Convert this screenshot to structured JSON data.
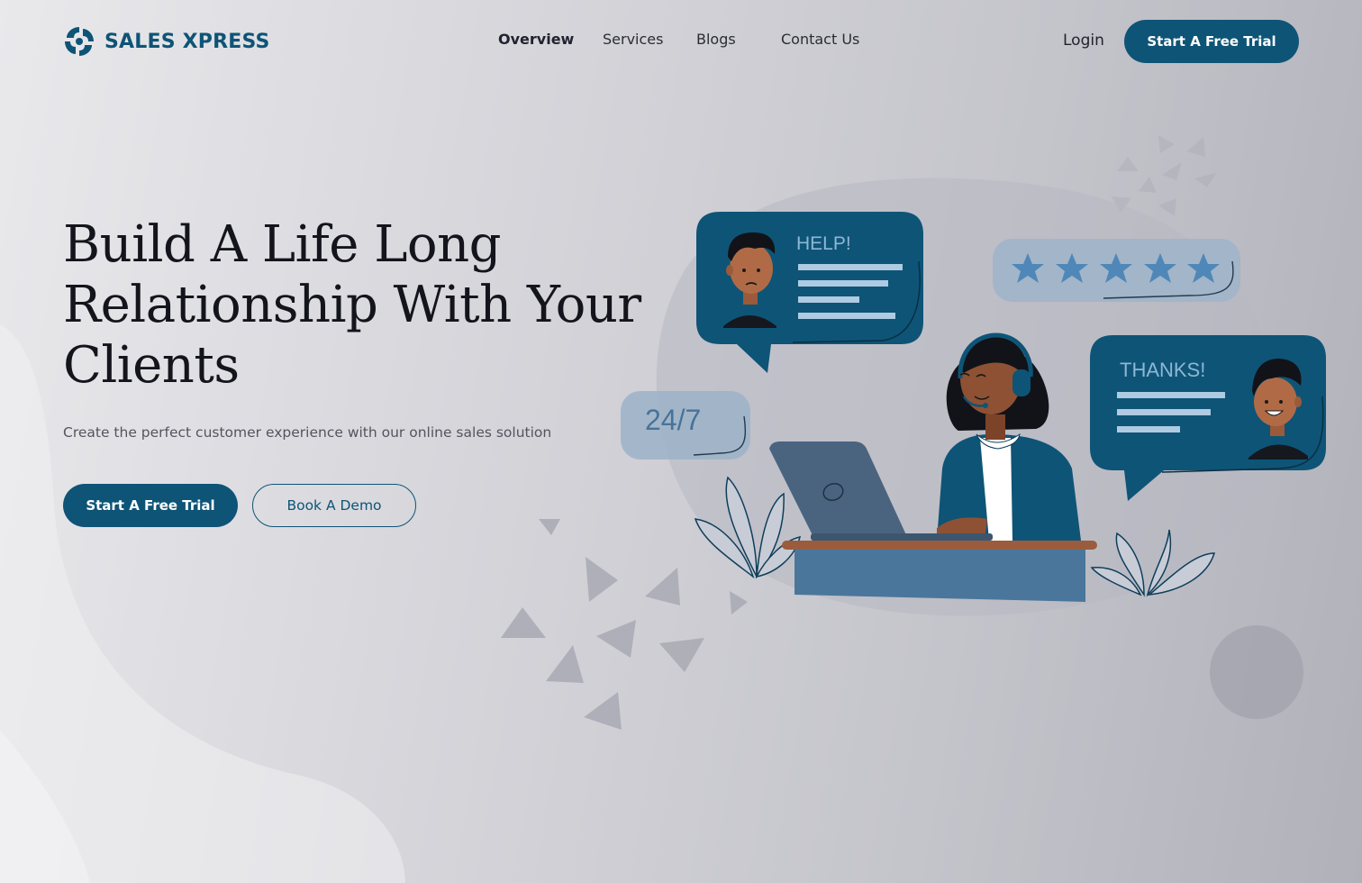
{
  "brand": {
    "name": "SALES XPRESS",
    "logo_icon": "swirl-logo-icon"
  },
  "nav": {
    "items": [
      {
        "label": "Overview",
        "active": true
      },
      {
        "label": "Services",
        "active": false
      },
      {
        "label": "Blogs",
        "active": false
      },
      {
        "label": "Contact Us",
        "active": false
      }
    ],
    "login_label": "Login",
    "cta_label": "Start A Free Trial"
  },
  "hero": {
    "title": "Build A Life Long Relationship With Your Clients",
    "subtitle": "Create the perfect customer experience with our online sales solution",
    "primary_button": "Start A Free Trial",
    "secondary_button": "Book A Demo"
  },
  "illustration": {
    "help_bubble_text": "HELP!",
    "thanks_bubble_text": "THANKS!",
    "availability_text": "24/7",
    "rating_stars": 5
  },
  "colors": {
    "brand_blue": "#0e5476",
    "light_blue": "#9fb4c9",
    "star_blue": "#4f88b8",
    "background": "#d6d6db"
  }
}
